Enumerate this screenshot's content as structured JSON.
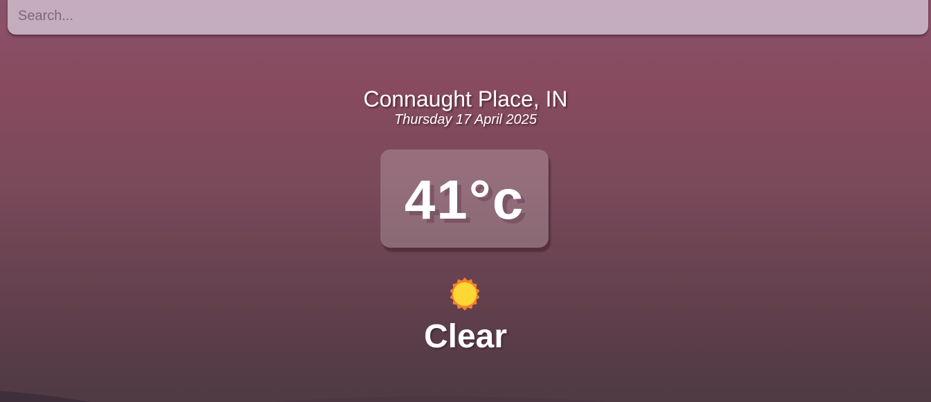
{
  "search": {
    "placeholder": "Search..."
  },
  "location": {
    "name": "Connaught Place, IN",
    "date": "Thursday 17 April 2025"
  },
  "weather": {
    "temperature": "41°c",
    "condition": "Clear",
    "icon": "sun-icon"
  },
  "colors": {
    "background_top": "#8a526b",
    "background_bottom": "#4f3a43",
    "sun_outer": "#f5822c",
    "sun_inner": "#fdd835"
  }
}
